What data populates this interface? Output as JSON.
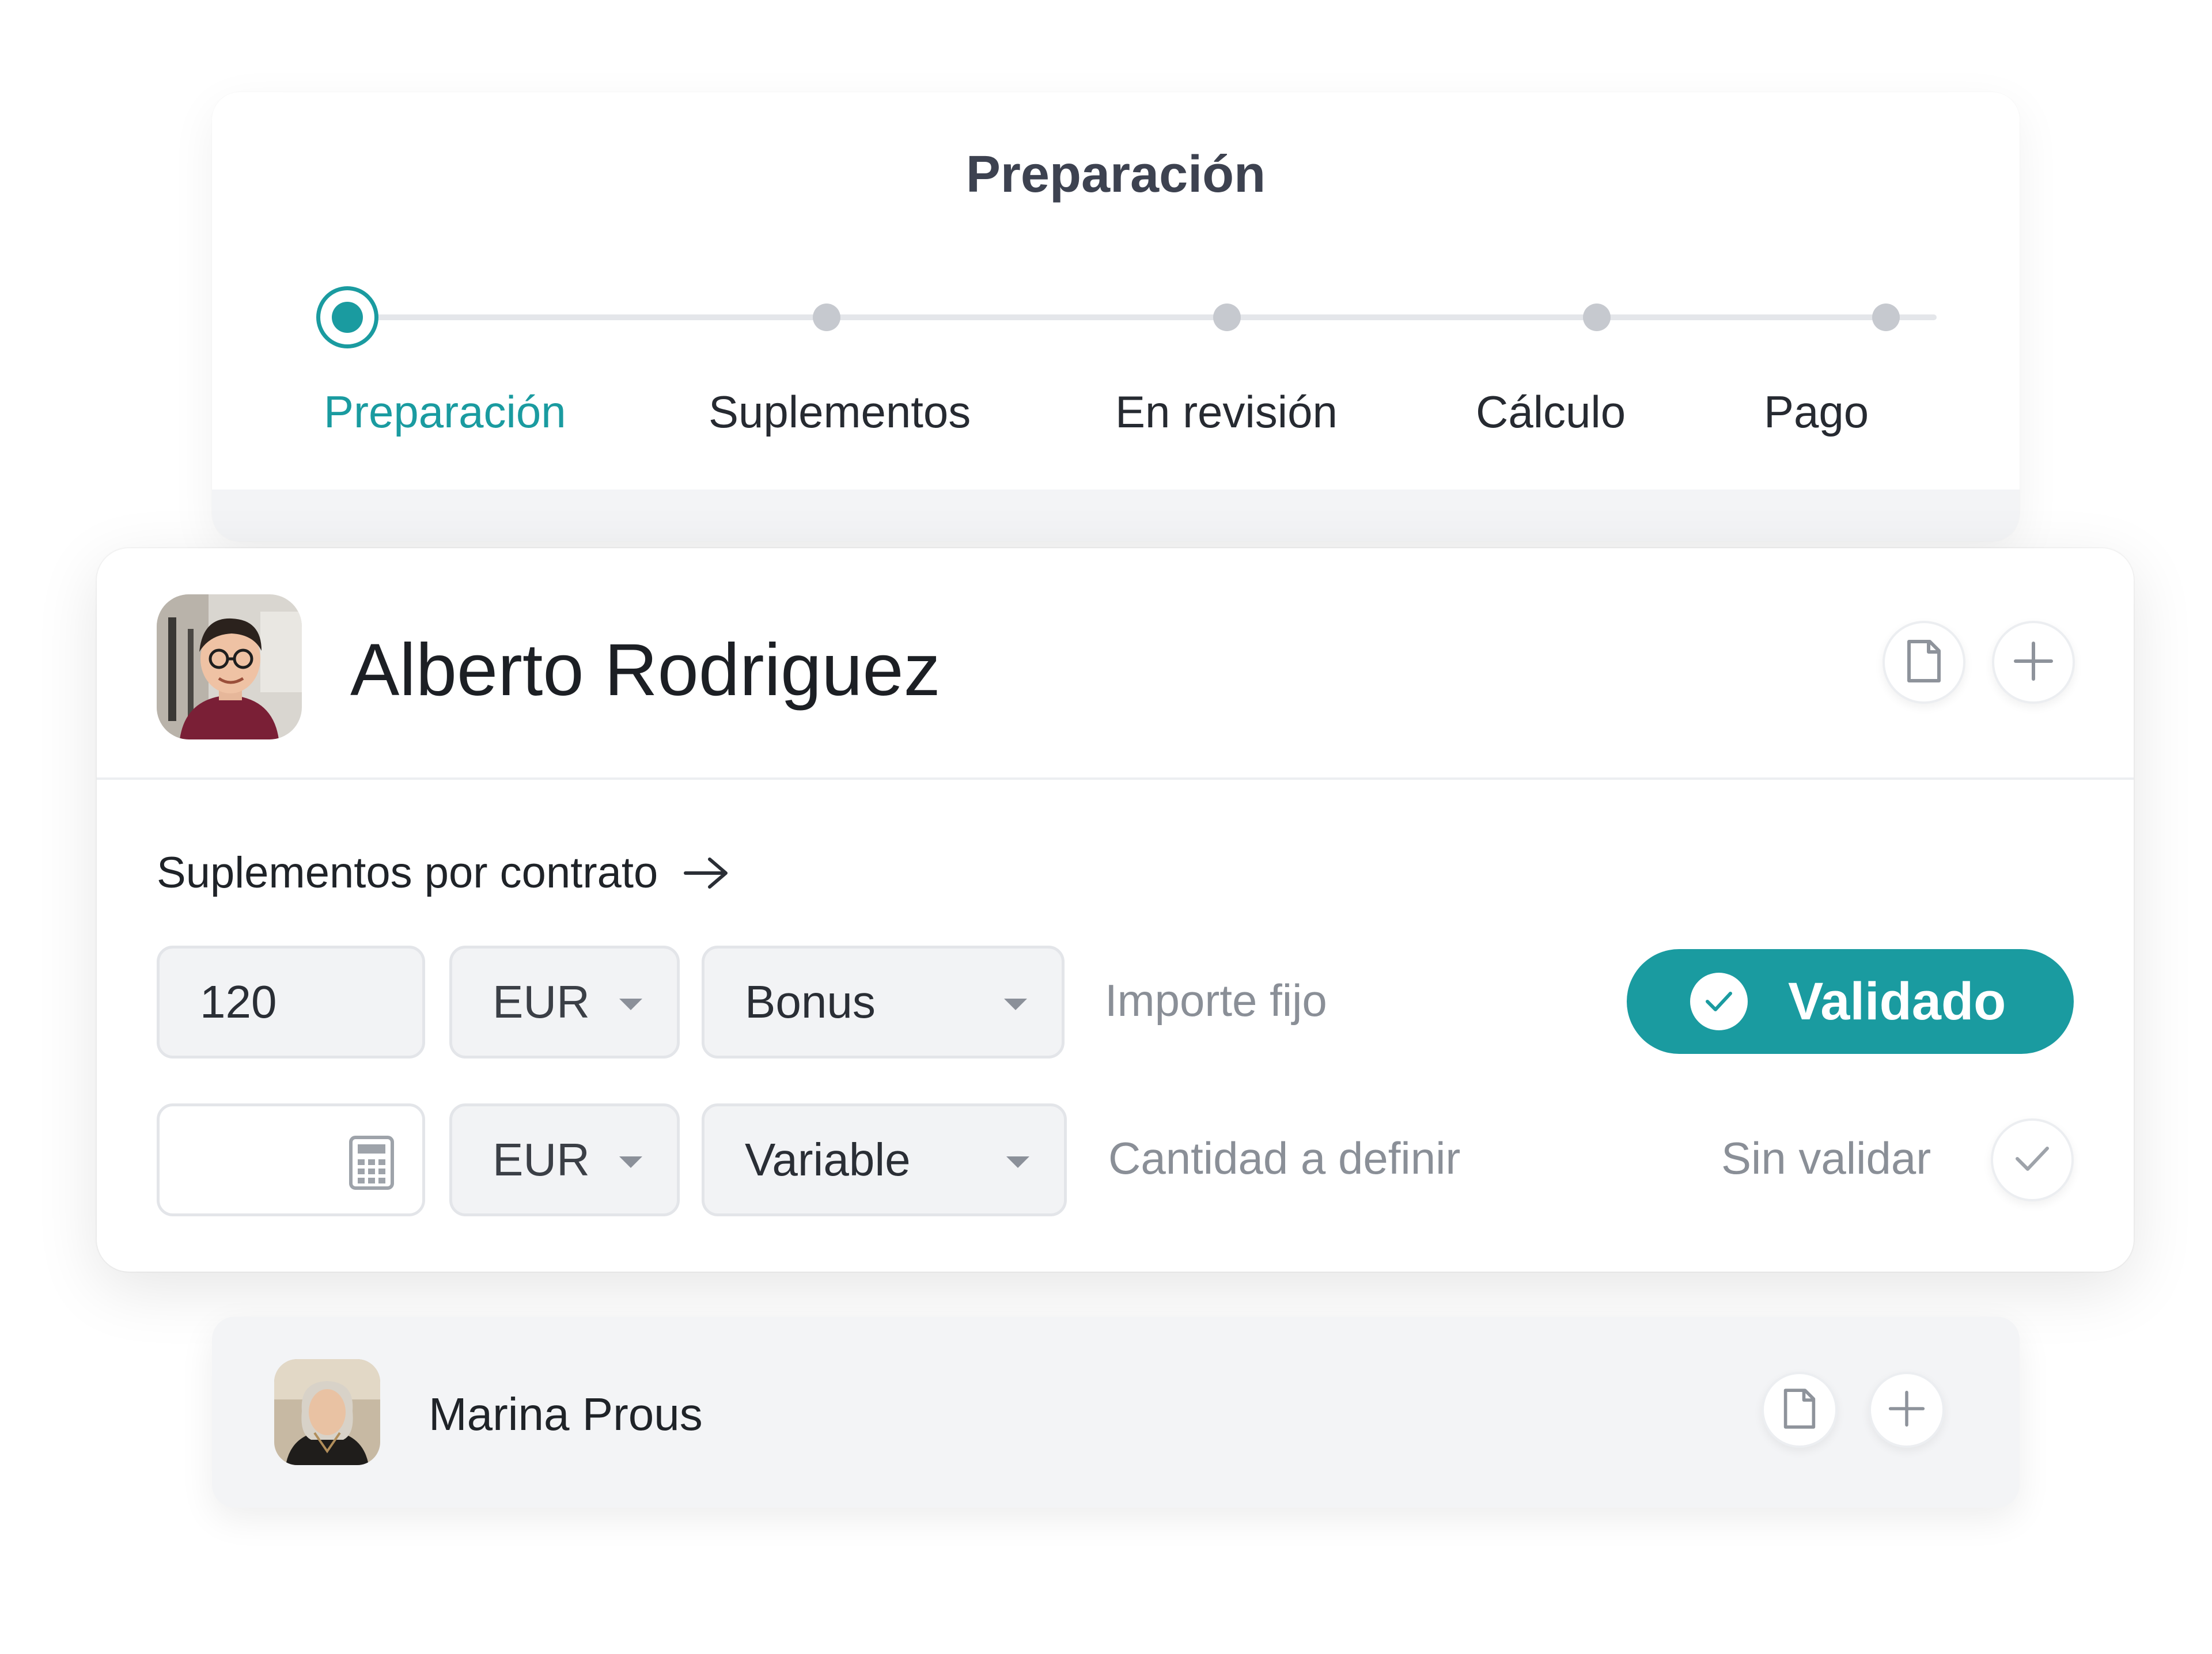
{
  "stepper": {
    "title": "Preparación",
    "steps": [
      {
        "label": "Preparación",
        "active": true
      },
      {
        "label": "Suplementos",
        "active": false
      },
      {
        "label": "En revisión",
        "active": false
      },
      {
        "label": "Cálculo",
        "active": false
      },
      {
        "label": "Pago",
        "active": false
      }
    ]
  },
  "employee": {
    "name": "Alberto Rodriguez",
    "section_title": "Suplementos por contrato",
    "rows": [
      {
        "amount": "120",
        "currency": "EUR",
        "type": "Bonus",
        "description": "Importe fijo",
        "status": "Validado"
      },
      {
        "amount": "",
        "currency": "EUR",
        "type": "Variable",
        "description": "Cantidad a definir",
        "status": "Sin validar"
      }
    ]
  },
  "employee2": {
    "name": "Marina Prous"
  },
  "icons": [
    "document-icon",
    "plus-icon",
    "arrow-right-icon",
    "calculator-icon",
    "check-icon",
    "chevron-down-icon"
  ],
  "colors": {
    "accent": "#1a9ba0",
    "muted_text": "#8a8f97",
    "field_bg": "#f2f3f5"
  }
}
